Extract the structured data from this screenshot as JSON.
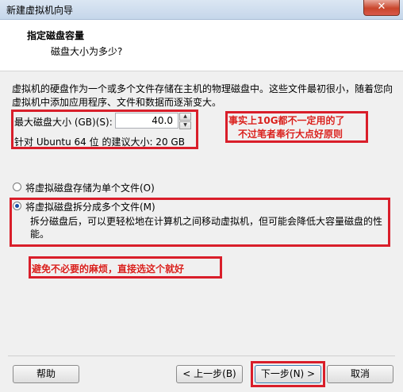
{
  "window": {
    "title": "新建虚拟机向导",
    "close_symbol": "✕"
  },
  "header": {
    "title": "指定磁盘容量",
    "subtitle": "磁盘大小为多少?"
  },
  "description": "虚拟机的硬盘作为一个或多个文件存储在主机的物理磁盘中。这些文件最初很小，随着您向虚拟机中添加应用程序、文件和数据而逐渐变大。",
  "disk": {
    "max_size_label": "最大磁盘大小 (GB)(S):",
    "max_size_value": "40.0",
    "recommended": "针对 Ubuntu 64 位 的建议大小: 20 GB"
  },
  "options": {
    "single_file": "将虚拟磁盘存储为单个文件(O)",
    "multi_file": "将虚拟磁盘拆分成多个文件(M)",
    "multi_file_desc": "拆分磁盘后，可以更轻松地在计算机之间移动虚拟机，但可能会降低大容量磁盘的性能。",
    "selected": "multi_file"
  },
  "annotations": {
    "note1_line1": "事实上10G都不一定用的了",
    "note1_line2": "不过笔者奉行大点好原则",
    "note2": "避免不必要的麻烦，直接选这个就好"
  },
  "buttons": {
    "help": "帮助",
    "back": "< 上一步(B)",
    "next": "下一步(N) >",
    "cancel": "取消"
  },
  "colors": {
    "annotation_red": "#d91e2a",
    "radio_selected": "#1a4fa5"
  }
}
